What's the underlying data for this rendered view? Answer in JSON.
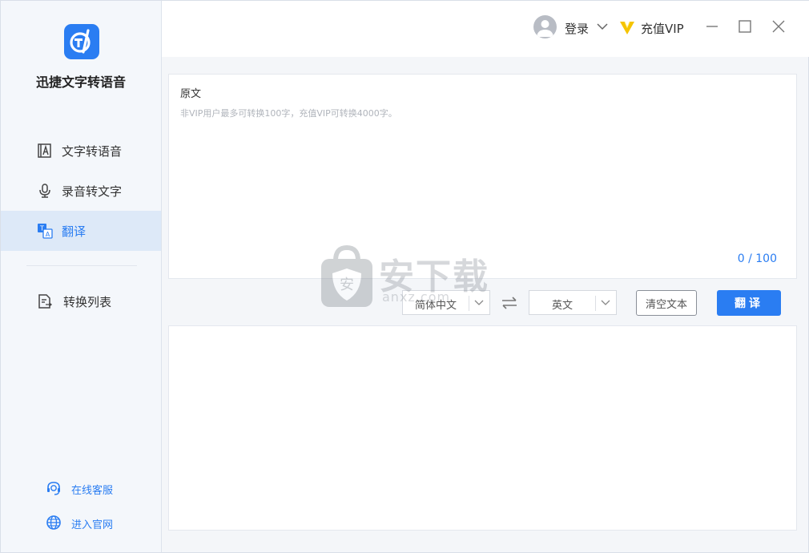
{
  "app": {
    "name": "迅捷文字转语音",
    "brand_color": "#2a7df2"
  },
  "sidebar": {
    "items": [
      {
        "label": "文字转语音",
        "icon": "text-to-speech-icon",
        "active": false
      },
      {
        "label": "录音转文字",
        "icon": "microphone-icon",
        "active": false
      },
      {
        "label": "翻译",
        "icon": "translate-icon",
        "active": true
      },
      {
        "label": "转换列表",
        "icon": "conversion-list-icon",
        "active": false
      }
    ],
    "footer": {
      "support_label": "在线客服",
      "website_label": "进入官网"
    }
  },
  "titlebar": {
    "login_label": "登录",
    "vip_label": "充值VIP",
    "vip_color": "#f5c400"
  },
  "source": {
    "title": "原文",
    "placeholder": "非VIP用户最多可转换100字，充值VIP可转换4000字。",
    "value": "",
    "counter": "0 / 100"
  },
  "controls": {
    "source_lang": "简体中文",
    "target_lang": "英文",
    "clear_label": "清空文本",
    "translate_label": "翻译"
  },
  "result": {
    "value": ""
  },
  "watermark": {
    "text": "安下载",
    "sub": "anxz.com"
  }
}
